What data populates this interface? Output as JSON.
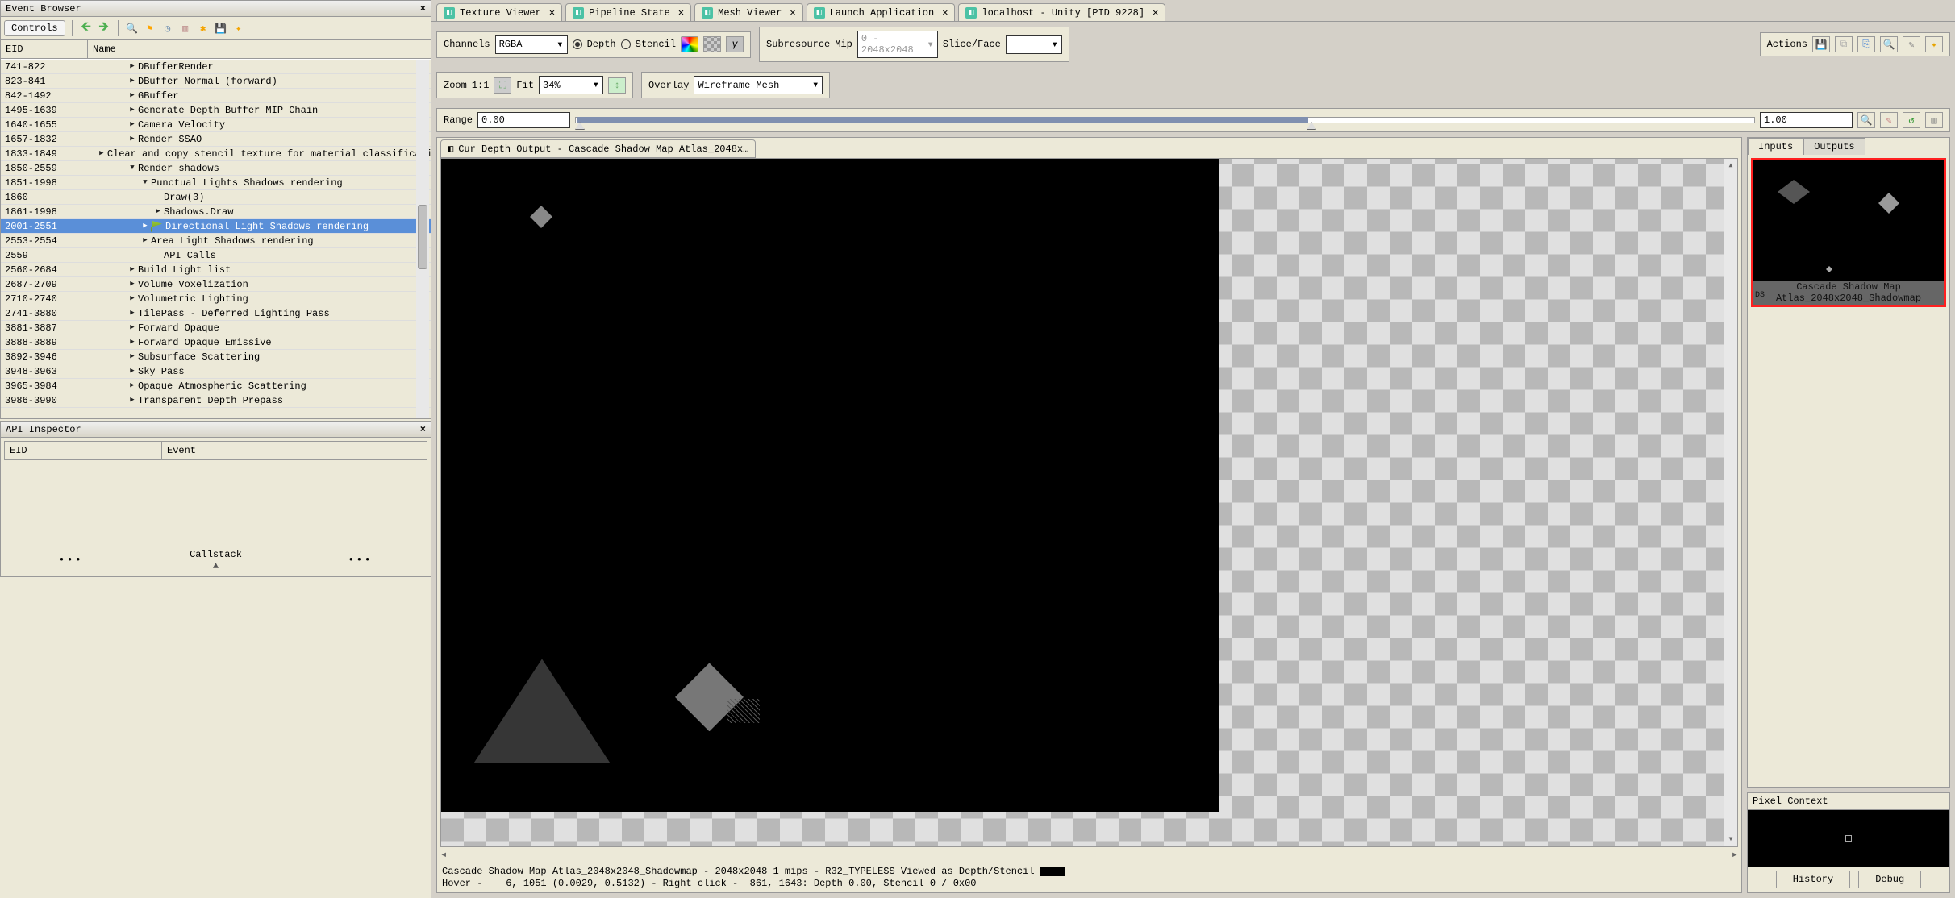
{
  "eventBrowser": {
    "title": "Event Browser",
    "controlsLabel": "Controls",
    "columns": {
      "eid": "EID",
      "name": "Name"
    },
    "rows": [
      {
        "eid": "741-822",
        "indent": 1,
        "exp": "right",
        "name": "DBufferRender"
      },
      {
        "eid": "823-841",
        "indent": 1,
        "exp": "right",
        "name": "DBuffer Normal (forward)"
      },
      {
        "eid": "842-1492",
        "indent": 1,
        "exp": "right",
        "name": "GBuffer"
      },
      {
        "eid": "1495-1639",
        "indent": 1,
        "exp": "right",
        "name": "Generate Depth Buffer MIP Chain"
      },
      {
        "eid": "1640-1655",
        "indent": 1,
        "exp": "right",
        "name": "Camera Velocity"
      },
      {
        "eid": "1657-1832",
        "indent": 1,
        "exp": "right",
        "name": "Render SSAO"
      },
      {
        "eid": "1833-1849",
        "indent": 1,
        "exp": "right",
        "name": "Clear and copy stencil texture for material classification"
      },
      {
        "eid": "1850-2559",
        "indent": 1,
        "exp": "down",
        "name": "Render shadows"
      },
      {
        "eid": "1851-1998",
        "indent": 2,
        "exp": "down",
        "name": "Punctual Lights Shadows rendering"
      },
      {
        "eid": "1860",
        "indent": 3,
        "exp": "",
        "name": "Draw(3)"
      },
      {
        "eid": "1861-1998",
        "indent": 3,
        "exp": "right",
        "name": "Shadows.Draw"
      },
      {
        "eid": "2001-2551",
        "indent": 2,
        "exp": "right",
        "name": "Directional Light Shadows rendering",
        "selected": true,
        "flag": true
      },
      {
        "eid": "2553-2554",
        "indent": 2,
        "exp": "right",
        "name": "Area Light Shadows rendering"
      },
      {
        "eid": "2559",
        "indent": 3,
        "exp": "",
        "name": "API Calls"
      },
      {
        "eid": "2560-2684",
        "indent": 1,
        "exp": "right",
        "name": "Build Light list"
      },
      {
        "eid": "2687-2709",
        "indent": 1,
        "exp": "right",
        "name": "Volume Voxelization"
      },
      {
        "eid": "2710-2740",
        "indent": 1,
        "exp": "right",
        "name": "Volumetric Lighting"
      },
      {
        "eid": "2741-3880",
        "indent": 1,
        "exp": "right",
        "name": "TilePass - Deferred Lighting Pass"
      },
      {
        "eid": "3881-3887",
        "indent": 1,
        "exp": "right",
        "name": "Forward Opaque"
      },
      {
        "eid": "3888-3889",
        "indent": 1,
        "exp": "right",
        "name": "Forward Opaque Emissive"
      },
      {
        "eid": "3892-3946",
        "indent": 1,
        "exp": "right",
        "name": "Subsurface Scattering"
      },
      {
        "eid": "3948-3963",
        "indent": 1,
        "exp": "right",
        "name": "Sky Pass"
      },
      {
        "eid": "3965-3984",
        "indent": 1,
        "exp": "right",
        "name": "Opaque Atmospheric Scattering"
      },
      {
        "eid": "3986-3990",
        "indent": 1,
        "exp": "right",
        "name": "Transparent Depth Prepass"
      }
    ]
  },
  "apiInspector": {
    "title": "API Inspector",
    "columns": {
      "eid": "EID",
      "event": "Event"
    },
    "callstack": "Callstack"
  },
  "mainTabs": [
    {
      "label": "Texture Viewer"
    },
    {
      "label": "Pipeline State"
    },
    {
      "label": "Mesh Viewer"
    },
    {
      "label": "Launch Application"
    },
    {
      "label": "localhost - Unity [PID 9228]"
    }
  ],
  "toolbar": {
    "channels": "Channels",
    "channelsValue": "RGBA",
    "depth": "Depth",
    "stencil": "Stencil",
    "gamma": "γ",
    "subresource": "Subresource",
    "mip": "Mip",
    "mipHint": "0 - 2048x2048",
    "sliceFace": "Slice/Face",
    "actions": "Actions",
    "zoom": "Zoom",
    "oneToOne": "1:1",
    "fit": "Fit",
    "zoomVal": "34%",
    "overlay": "Overlay",
    "overlayValue": "Wireframe Mesh",
    "range": "Range",
    "rangeLo": "0.00",
    "rangeHi": "1.00"
  },
  "viewer": {
    "tabLabel": "Cur Depth Output - Cascade Shadow Map Atlas_2048x…",
    "status1": "Cascade Shadow Map Atlas_2048x2048_Shadowmap - 2048x2048 1 mips - R32_TYPELESS Viewed as Depth/Stencil ",
    "status2": "Hover -    6, 1051 (0.0029, 0.5132) - Right click -  861, 1643: Depth 0.00, Stencil 0 / 0x00"
  },
  "io": {
    "inputs": "Inputs",
    "outputs": "Outputs",
    "thumbDS": "DS",
    "thumbLabel": "Cascade Shadow Map Atlas_2048x2048_Shadowmap"
  },
  "pixelContext": {
    "title": "Pixel Context",
    "history": "History",
    "debug": "Debug"
  }
}
